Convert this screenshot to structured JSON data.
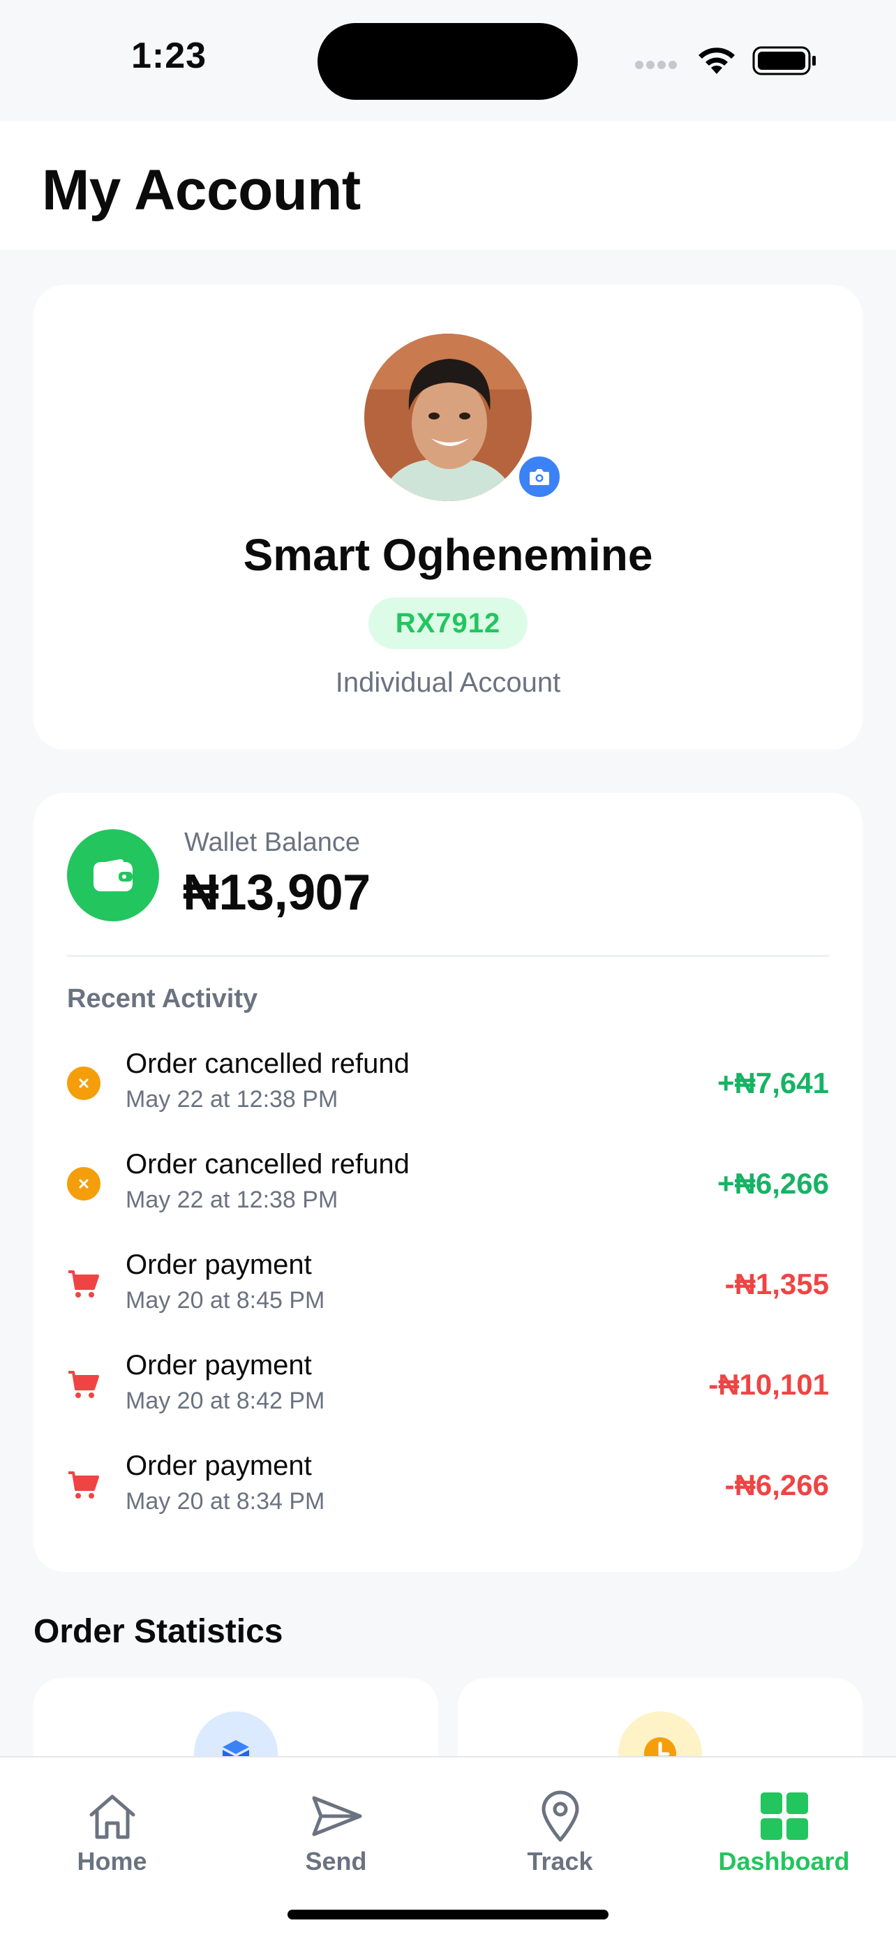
{
  "status_bar": {
    "time": "1:23"
  },
  "header": {
    "title": "My Account"
  },
  "profile": {
    "name": "Smart Oghenemine",
    "code": "RX7912",
    "account_type": "Individual Account"
  },
  "wallet": {
    "label": "Wallet Balance",
    "balance": "₦13,907",
    "recent_activity_title": "Recent Activity",
    "activities": [
      {
        "title": "Order cancelled refund",
        "date": "May 22 at 12:38 PM",
        "amount": "+₦7,641",
        "type": "refund",
        "icon": "cancel-circle-icon"
      },
      {
        "title": "Order cancelled refund",
        "date": "May 22 at 12:38 PM",
        "amount": "+₦6,266",
        "type": "refund",
        "icon": "cancel-circle-icon"
      },
      {
        "title": "Order payment",
        "date": "May 20 at 8:45 PM",
        "amount": "-₦1,355",
        "type": "payment",
        "icon": "cart-icon"
      },
      {
        "title": "Order payment",
        "date": "May 20 at 8:42 PM",
        "amount": "-₦10,101",
        "type": "payment",
        "icon": "cart-icon"
      },
      {
        "title": "Order payment",
        "date": "May 20 at 8:34 PM",
        "amount": "-₦6,266",
        "type": "payment",
        "icon": "cart-icon"
      }
    ]
  },
  "order_statistics": {
    "title": "Order Statistics"
  },
  "tab_bar": {
    "tabs": [
      {
        "label": "Home",
        "icon": "home-icon",
        "active": false
      },
      {
        "label": "Send",
        "icon": "send-icon",
        "active": false
      },
      {
        "label": "Track",
        "icon": "location-pin-icon",
        "active": false
      },
      {
        "label": "Dashboard",
        "icon": "dashboard-grid-icon",
        "active": true
      }
    ]
  },
  "colors": {
    "accent_green": "#22c55e",
    "positive_amount": "#16b364",
    "negative_amount": "#ef4444",
    "refund_orange": "#f59e0b",
    "camera_blue": "#3b82f6"
  }
}
